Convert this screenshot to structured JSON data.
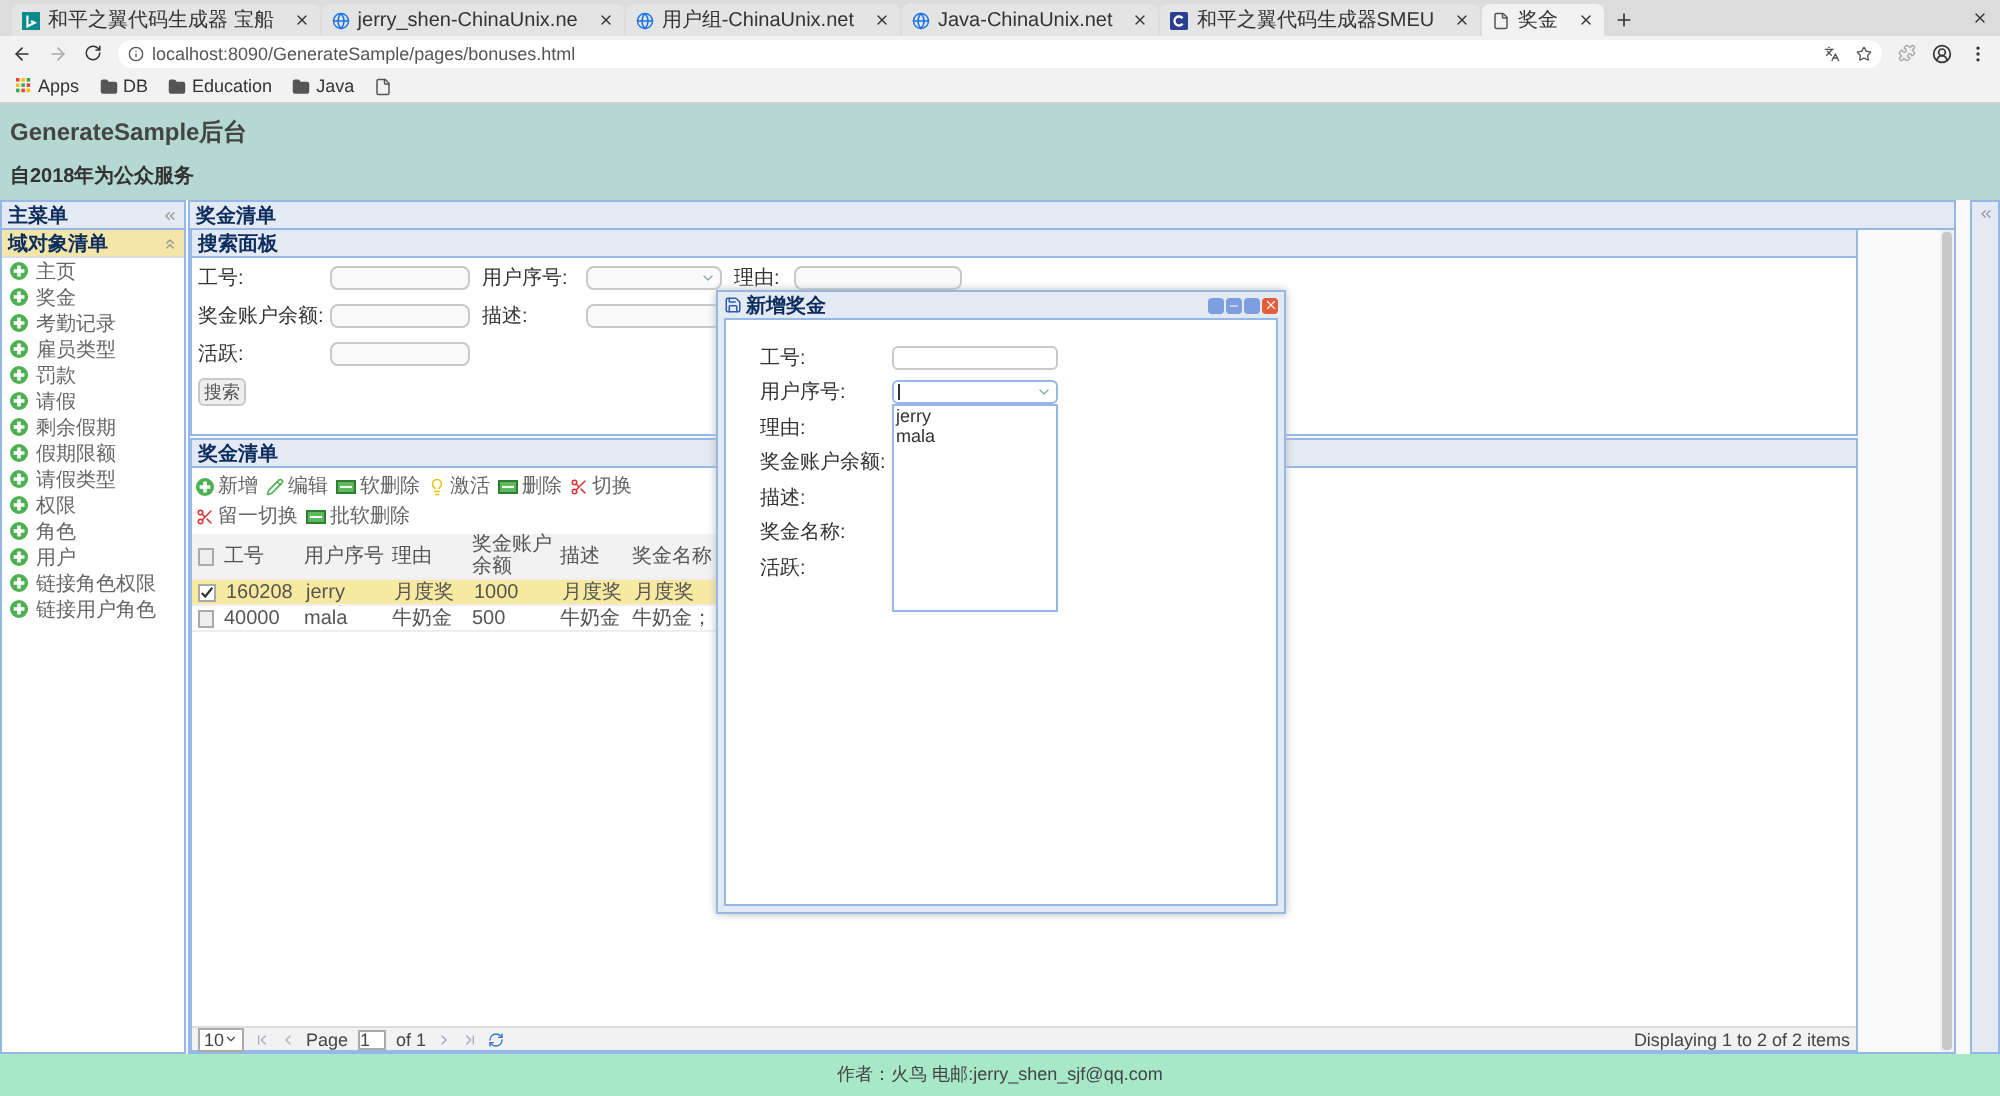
{
  "browser": {
    "tabs": [
      {
        "kind": "bing",
        "title": "和平之翼代码生成器 宝船",
        "selected": false
      },
      {
        "kind": "globe",
        "title": "jerry_shen-ChinaUnix.ne",
        "selected": false
      },
      {
        "kind": "globe",
        "title": "用户组-ChinaUnix.net",
        "selected": false
      },
      {
        "kind": "globe",
        "title": "Java-ChinaUnix.net",
        "selected": false
      },
      {
        "kind": "gen",
        "title": "和平之翼代码生成器SMEU",
        "selected": false
      },
      {
        "kind": "page",
        "title": "奖金",
        "selected": true
      }
    ],
    "address": "localhost:8090/GenerateSample/pages/bonuses.html",
    "bookmarks": [
      {
        "kind": "apps",
        "label": "Apps"
      },
      {
        "kind": "folder",
        "label": "DB"
      },
      {
        "kind": "folder",
        "label": "Education"
      },
      {
        "kind": "folder",
        "label": "Java"
      },
      {
        "kind": "page"
      }
    ]
  },
  "header": {
    "title": "GenerateSample后台",
    "subtitle": "自2018年为公众服务"
  },
  "sidebar": {
    "title": "主菜单",
    "section": {
      "title": "域对象清单",
      "expanded": true
    },
    "items": [
      "主页",
      "奖金",
      "考勤记录",
      "雇员类型",
      "罚款",
      "请假",
      "剩余假期",
      "假期限额",
      "请假类型",
      "权限",
      "角色",
      "用户",
      "链接角色权限",
      "链接用户角色"
    ]
  },
  "main": {
    "title": "奖金清单",
    "search_panel": {
      "title": "搜索面板",
      "rows": [
        [
          {
            "label": "工号:",
            "kind": "text"
          },
          {
            "label": "用户序号:",
            "kind": "combo"
          },
          {
            "label": "理由:",
            "kind": "text"
          }
        ],
        [
          {
            "label": "奖金账户余额:",
            "kind": "text"
          },
          {
            "label": "描述:",
            "kind": "text"
          }
        ],
        [
          {
            "label": "活跃:",
            "kind": "text"
          }
        ]
      ],
      "button": "搜索"
    },
    "grid": {
      "title": "奖金清单",
      "toolbar": [
        {
          "kind": "plus",
          "label": "新增"
        },
        {
          "kind": "pencil",
          "label": "编辑"
        },
        {
          "kind": "minus",
          "label": "软删除"
        },
        {
          "kind": "bulb",
          "label": "激活"
        },
        {
          "kind": "minus",
          "label": "删除"
        },
        {
          "kind": "cut",
          "label": "切换"
        },
        {
          "kind": "cut",
          "label": "留一切换"
        },
        {
          "kind": "minus",
          "label": "批软删除"
        }
      ],
      "header_checked": false,
      "columns": [
        "工号",
        "用户序号",
        "理由",
        "奖金账户余额",
        "描述",
        "奖金名称"
      ],
      "rows": [
        {
          "selected": true,
          "checked": true,
          "cells": [
            "160208",
            "jerry",
            "月度奖",
            "1000",
            "月度奖",
            "月度奖"
          ]
        },
        {
          "selected": false,
          "checked": false,
          "cells": [
            "40000",
            "mala",
            "牛奶金",
            "500",
            "牛奶金",
            "牛奶金；"
          ]
        }
      ]
    },
    "pager": {
      "page_size": "10",
      "page_label": "Page",
      "page": "1",
      "of": "of 1",
      "summary": "Displaying 1 to 2 of 2 items"
    }
  },
  "dialog": {
    "title": "新增奖金",
    "fields": [
      {
        "label": "工号:",
        "kind": "text"
      },
      {
        "label": "用户序号:",
        "kind": "combo",
        "open": true,
        "options": [
          "jerry",
          "mala"
        ]
      },
      {
        "label": "理由:",
        "kind": "none"
      },
      {
        "label": "奖金账户余额:",
        "kind": "none"
      },
      {
        "label": "描述:",
        "kind": "none"
      },
      {
        "label": "奖金名称:",
        "kind": "none"
      },
      {
        "label": "活跃:",
        "kind": "none"
      }
    ]
  },
  "footer": "作者：火鸟 电邮:jerry_shen_sjf@qq.com"
}
